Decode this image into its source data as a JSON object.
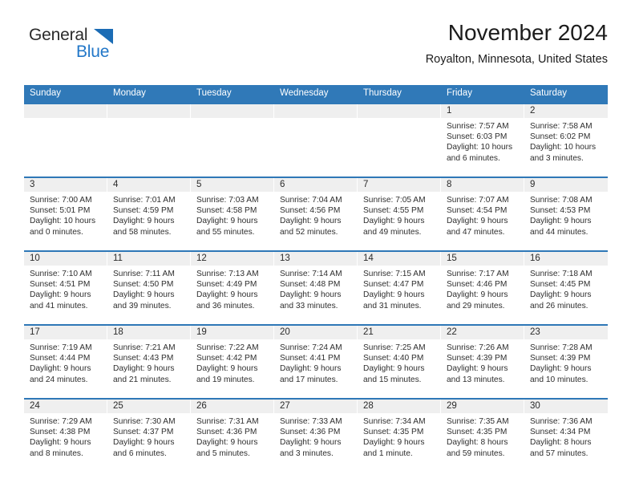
{
  "brand": {
    "name_part1": "General",
    "name_part2": "Blue",
    "triangle_icon": "triangle-icon",
    "accent_color": "#2277c8"
  },
  "header": {
    "title": "November 2024",
    "subtitle": "Royalton, Minnesota, United States"
  },
  "theme": {
    "header_row_bg": "#3079b8",
    "week_divider": "#2f78b7",
    "daynum_band_bg": "#efefef",
    "text": "#2e2e2e"
  },
  "weekdays": [
    "Sunday",
    "Monday",
    "Tuesday",
    "Wednesday",
    "Thursday",
    "Friday",
    "Saturday"
  ],
  "weeks": [
    [
      {
        "day": "",
        "empty": true
      },
      {
        "day": "",
        "empty": true
      },
      {
        "day": "",
        "empty": true
      },
      {
        "day": "",
        "empty": true
      },
      {
        "day": "",
        "empty": true
      },
      {
        "day": "1",
        "sunrise": "Sunrise: 7:57 AM",
        "sunset": "Sunset: 6:03 PM",
        "daylight1": "Daylight: 10 hours",
        "daylight2": "and 6 minutes."
      },
      {
        "day": "2",
        "sunrise": "Sunrise: 7:58 AM",
        "sunset": "Sunset: 6:02 PM",
        "daylight1": "Daylight: 10 hours",
        "daylight2": "and 3 minutes."
      }
    ],
    [
      {
        "day": "3",
        "sunrise": "Sunrise: 7:00 AM",
        "sunset": "Sunset: 5:01 PM",
        "daylight1": "Daylight: 10 hours",
        "daylight2": "and 0 minutes."
      },
      {
        "day": "4",
        "sunrise": "Sunrise: 7:01 AM",
        "sunset": "Sunset: 4:59 PM",
        "daylight1": "Daylight: 9 hours",
        "daylight2": "and 58 minutes."
      },
      {
        "day": "5",
        "sunrise": "Sunrise: 7:03 AM",
        "sunset": "Sunset: 4:58 PM",
        "daylight1": "Daylight: 9 hours",
        "daylight2": "and 55 minutes."
      },
      {
        "day": "6",
        "sunrise": "Sunrise: 7:04 AM",
        "sunset": "Sunset: 4:56 PM",
        "daylight1": "Daylight: 9 hours",
        "daylight2": "and 52 minutes."
      },
      {
        "day": "7",
        "sunrise": "Sunrise: 7:05 AM",
        "sunset": "Sunset: 4:55 PM",
        "daylight1": "Daylight: 9 hours",
        "daylight2": "and 49 minutes."
      },
      {
        "day": "8",
        "sunrise": "Sunrise: 7:07 AM",
        "sunset": "Sunset: 4:54 PM",
        "daylight1": "Daylight: 9 hours",
        "daylight2": "and 47 minutes."
      },
      {
        "day": "9",
        "sunrise": "Sunrise: 7:08 AM",
        "sunset": "Sunset: 4:53 PM",
        "daylight1": "Daylight: 9 hours",
        "daylight2": "and 44 minutes."
      }
    ],
    [
      {
        "day": "10",
        "sunrise": "Sunrise: 7:10 AM",
        "sunset": "Sunset: 4:51 PM",
        "daylight1": "Daylight: 9 hours",
        "daylight2": "and 41 minutes."
      },
      {
        "day": "11",
        "sunrise": "Sunrise: 7:11 AM",
        "sunset": "Sunset: 4:50 PM",
        "daylight1": "Daylight: 9 hours",
        "daylight2": "and 39 minutes."
      },
      {
        "day": "12",
        "sunrise": "Sunrise: 7:13 AM",
        "sunset": "Sunset: 4:49 PM",
        "daylight1": "Daylight: 9 hours",
        "daylight2": "and 36 minutes."
      },
      {
        "day": "13",
        "sunrise": "Sunrise: 7:14 AM",
        "sunset": "Sunset: 4:48 PM",
        "daylight1": "Daylight: 9 hours",
        "daylight2": "and 33 minutes."
      },
      {
        "day": "14",
        "sunrise": "Sunrise: 7:15 AM",
        "sunset": "Sunset: 4:47 PM",
        "daylight1": "Daylight: 9 hours",
        "daylight2": "and 31 minutes."
      },
      {
        "day": "15",
        "sunrise": "Sunrise: 7:17 AM",
        "sunset": "Sunset: 4:46 PM",
        "daylight1": "Daylight: 9 hours",
        "daylight2": "and 29 minutes."
      },
      {
        "day": "16",
        "sunrise": "Sunrise: 7:18 AM",
        "sunset": "Sunset: 4:45 PM",
        "daylight1": "Daylight: 9 hours",
        "daylight2": "and 26 minutes."
      }
    ],
    [
      {
        "day": "17",
        "sunrise": "Sunrise: 7:19 AM",
        "sunset": "Sunset: 4:44 PM",
        "daylight1": "Daylight: 9 hours",
        "daylight2": "and 24 minutes."
      },
      {
        "day": "18",
        "sunrise": "Sunrise: 7:21 AM",
        "sunset": "Sunset: 4:43 PM",
        "daylight1": "Daylight: 9 hours",
        "daylight2": "and 21 minutes."
      },
      {
        "day": "19",
        "sunrise": "Sunrise: 7:22 AM",
        "sunset": "Sunset: 4:42 PM",
        "daylight1": "Daylight: 9 hours",
        "daylight2": "and 19 minutes."
      },
      {
        "day": "20",
        "sunrise": "Sunrise: 7:24 AM",
        "sunset": "Sunset: 4:41 PM",
        "daylight1": "Daylight: 9 hours",
        "daylight2": "and 17 minutes."
      },
      {
        "day": "21",
        "sunrise": "Sunrise: 7:25 AM",
        "sunset": "Sunset: 4:40 PM",
        "daylight1": "Daylight: 9 hours",
        "daylight2": "and 15 minutes."
      },
      {
        "day": "22",
        "sunrise": "Sunrise: 7:26 AM",
        "sunset": "Sunset: 4:39 PM",
        "daylight1": "Daylight: 9 hours",
        "daylight2": "and 13 minutes."
      },
      {
        "day": "23",
        "sunrise": "Sunrise: 7:28 AM",
        "sunset": "Sunset: 4:39 PM",
        "daylight1": "Daylight: 9 hours",
        "daylight2": "and 10 minutes."
      }
    ],
    [
      {
        "day": "24",
        "sunrise": "Sunrise: 7:29 AM",
        "sunset": "Sunset: 4:38 PM",
        "daylight1": "Daylight: 9 hours",
        "daylight2": "and 8 minutes."
      },
      {
        "day": "25",
        "sunrise": "Sunrise: 7:30 AM",
        "sunset": "Sunset: 4:37 PM",
        "daylight1": "Daylight: 9 hours",
        "daylight2": "and 6 minutes."
      },
      {
        "day": "26",
        "sunrise": "Sunrise: 7:31 AM",
        "sunset": "Sunset: 4:36 PM",
        "daylight1": "Daylight: 9 hours",
        "daylight2": "and 5 minutes."
      },
      {
        "day": "27",
        "sunrise": "Sunrise: 7:33 AM",
        "sunset": "Sunset: 4:36 PM",
        "daylight1": "Daylight: 9 hours",
        "daylight2": "and 3 minutes."
      },
      {
        "day": "28",
        "sunrise": "Sunrise: 7:34 AM",
        "sunset": "Sunset: 4:35 PM",
        "daylight1": "Daylight: 9 hours",
        "daylight2": "and 1 minute."
      },
      {
        "day": "29",
        "sunrise": "Sunrise: 7:35 AM",
        "sunset": "Sunset: 4:35 PM",
        "daylight1": "Daylight: 8 hours",
        "daylight2": "and 59 minutes."
      },
      {
        "day": "30",
        "sunrise": "Sunrise: 7:36 AM",
        "sunset": "Sunset: 4:34 PM",
        "daylight1": "Daylight: 8 hours",
        "daylight2": "and 57 minutes."
      }
    ]
  ]
}
